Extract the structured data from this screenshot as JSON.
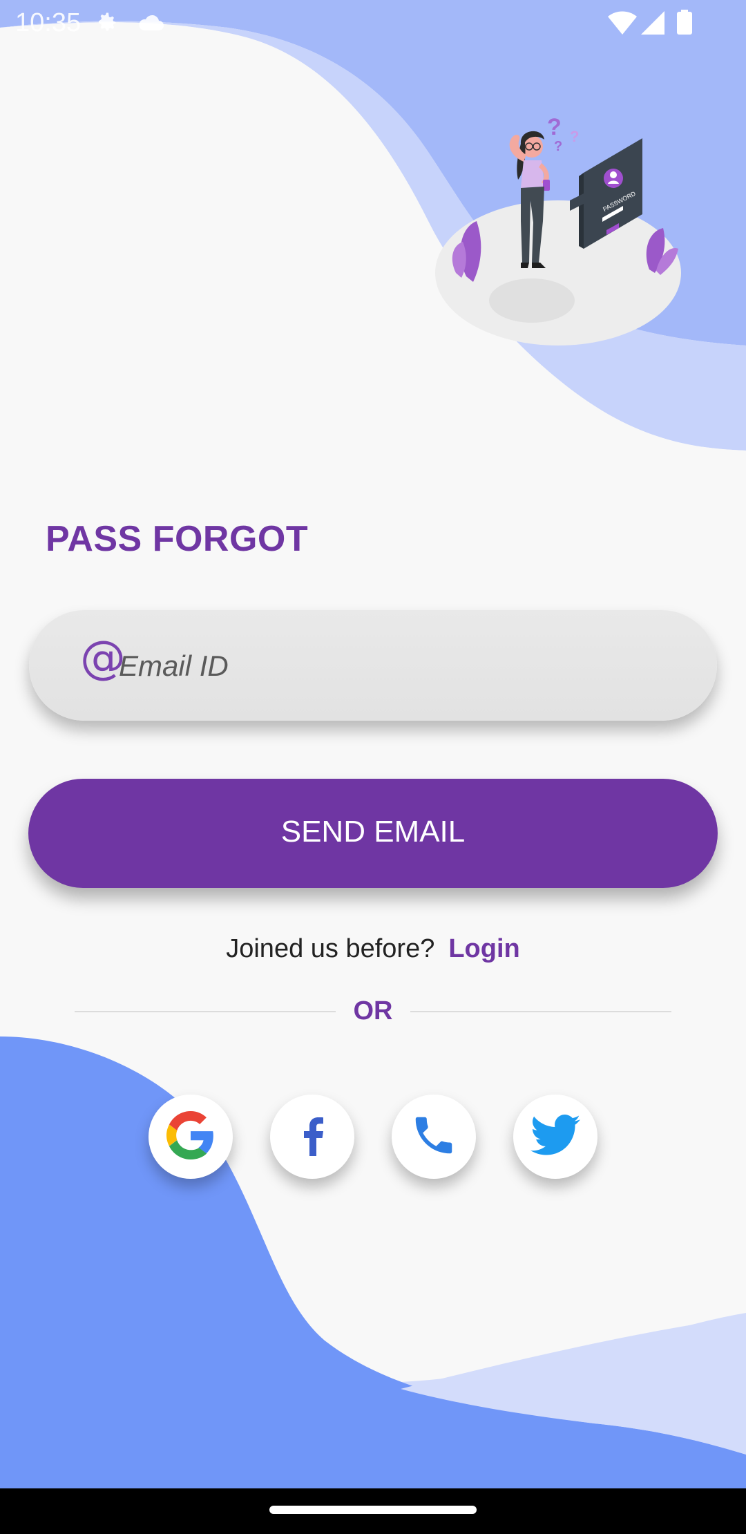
{
  "status_bar": {
    "time": "10:35",
    "icons": [
      "settings-icon",
      "cloud-icon",
      "wifi-icon",
      "signal-icon",
      "battery-icon"
    ]
  },
  "illustration": {
    "icon": "forgot-password-illustration",
    "card_text": "PASSWORD"
  },
  "title": "PASS FORGOT",
  "email_field": {
    "icon": "at-icon",
    "at_symbol": "@",
    "placeholder": "Email ID",
    "value": ""
  },
  "send_button": {
    "label": "SEND EMAIL"
  },
  "joined": {
    "text": "Joined us before?",
    "link": "Login"
  },
  "divider": {
    "label": "OR"
  },
  "social": [
    {
      "name": "google",
      "icon": "google-icon"
    },
    {
      "name": "facebook",
      "icon": "facebook-icon"
    },
    {
      "name": "phone",
      "icon": "phone-icon"
    },
    {
      "name": "twitter",
      "icon": "twitter-icon"
    }
  ],
  "colors": {
    "primary": "#6f36a3",
    "wave_blue": "#7096f8",
    "wave_light": "#c6d2fb",
    "background": "#f8f8f8"
  }
}
